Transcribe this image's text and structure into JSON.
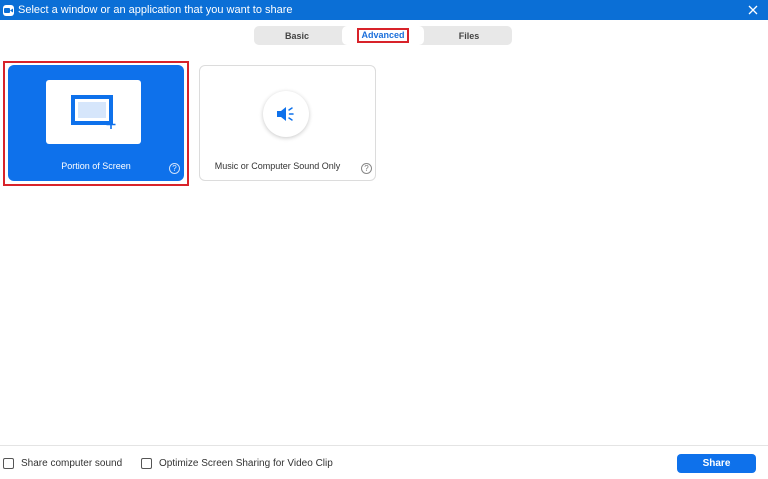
{
  "window": {
    "title": "Select a window or an application that you want to share",
    "app_icon": "zoom-camera-icon",
    "close_icon": "close-icon"
  },
  "tabs": [
    {
      "label": "Basic",
      "selected": false
    },
    {
      "label": "Advanced",
      "selected": true
    },
    {
      "label": "Files",
      "selected": false
    }
  ],
  "cards": {
    "portion": {
      "label": "Portion of Screen",
      "icon": "screen-portion-icon",
      "help": "?",
      "selected": true
    },
    "music": {
      "label": "Music or Computer Sound Only",
      "icon": "speaker-icon",
      "help": "?",
      "selected": false
    }
  },
  "footer": {
    "share_sound_label": "Share computer sound",
    "share_sound_checked": false,
    "optimize_label": "Optimize Screen Sharing for Video Clip",
    "optimize_checked": false,
    "share_button": "Share"
  },
  "colors": {
    "title_bar": "#0b6fd6",
    "accent": "#0e71eb",
    "highlight_outline": "#d8232a"
  }
}
